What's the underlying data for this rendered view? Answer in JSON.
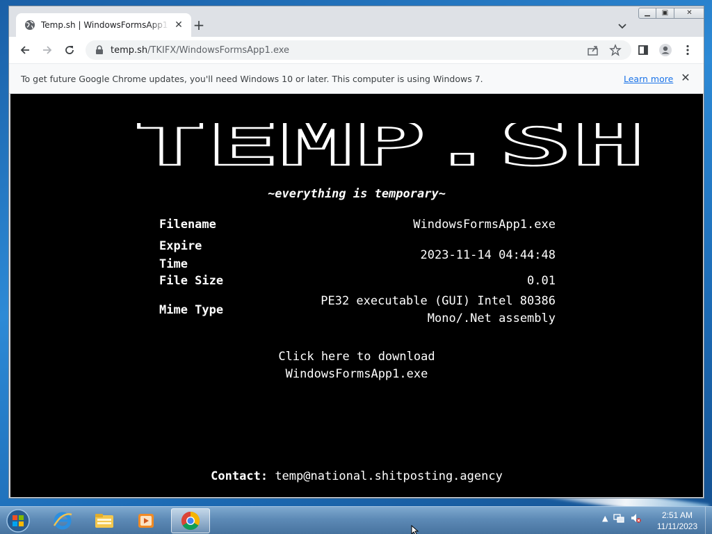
{
  "browser": {
    "tab_title": "Temp.sh | WindowsFormsApp1.exe",
    "url_host": "temp.sh",
    "url_path": "/TKIFX/WindowsFormsApp1.exe",
    "infobar_message": "To get future Google Chrome updates, you'll need Windows 10 or later. This computer is using Windows 7.",
    "infobar_link": "Learn more"
  },
  "page": {
    "logo_text": "TEMP.SH",
    "tagline": "~everything is temporary~",
    "fields": {
      "filename_label": "Filename",
      "filename_value": "WindowsFormsApp1.exe",
      "expire_label_1": "Expire",
      "expire_label_2": "Time",
      "expire_value": "2023-11-14 04:44:48",
      "size_label": "File Size",
      "size_value": "0.01",
      "mime_label": "Mime Type",
      "mime_value_1": "PE32 executable (GUI) Intel 80386",
      "mime_value_2": "Mono/.Net assembly"
    },
    "download_line_1": "Click here to download",
    "download_line_2": "WindowsFormsApp1.exe",
    "contact_label": "Contact:",
    "contact_email": "temp@national.shitposting.agency"
  },
  "taskbar": {
    "time": "2:51 AM",
    "date": "11/11/2023",
    "apps": [
      "internet-explorer-icon",
      "file-explorer-icon",
      "media-player-icon",
      "chrome-icon"
    ]
  },
  "colors": {
    "page_bg": "#000000",
    "page_fg": "#ffffff",
    "link_blue": "#1a73e8"
  }
}
